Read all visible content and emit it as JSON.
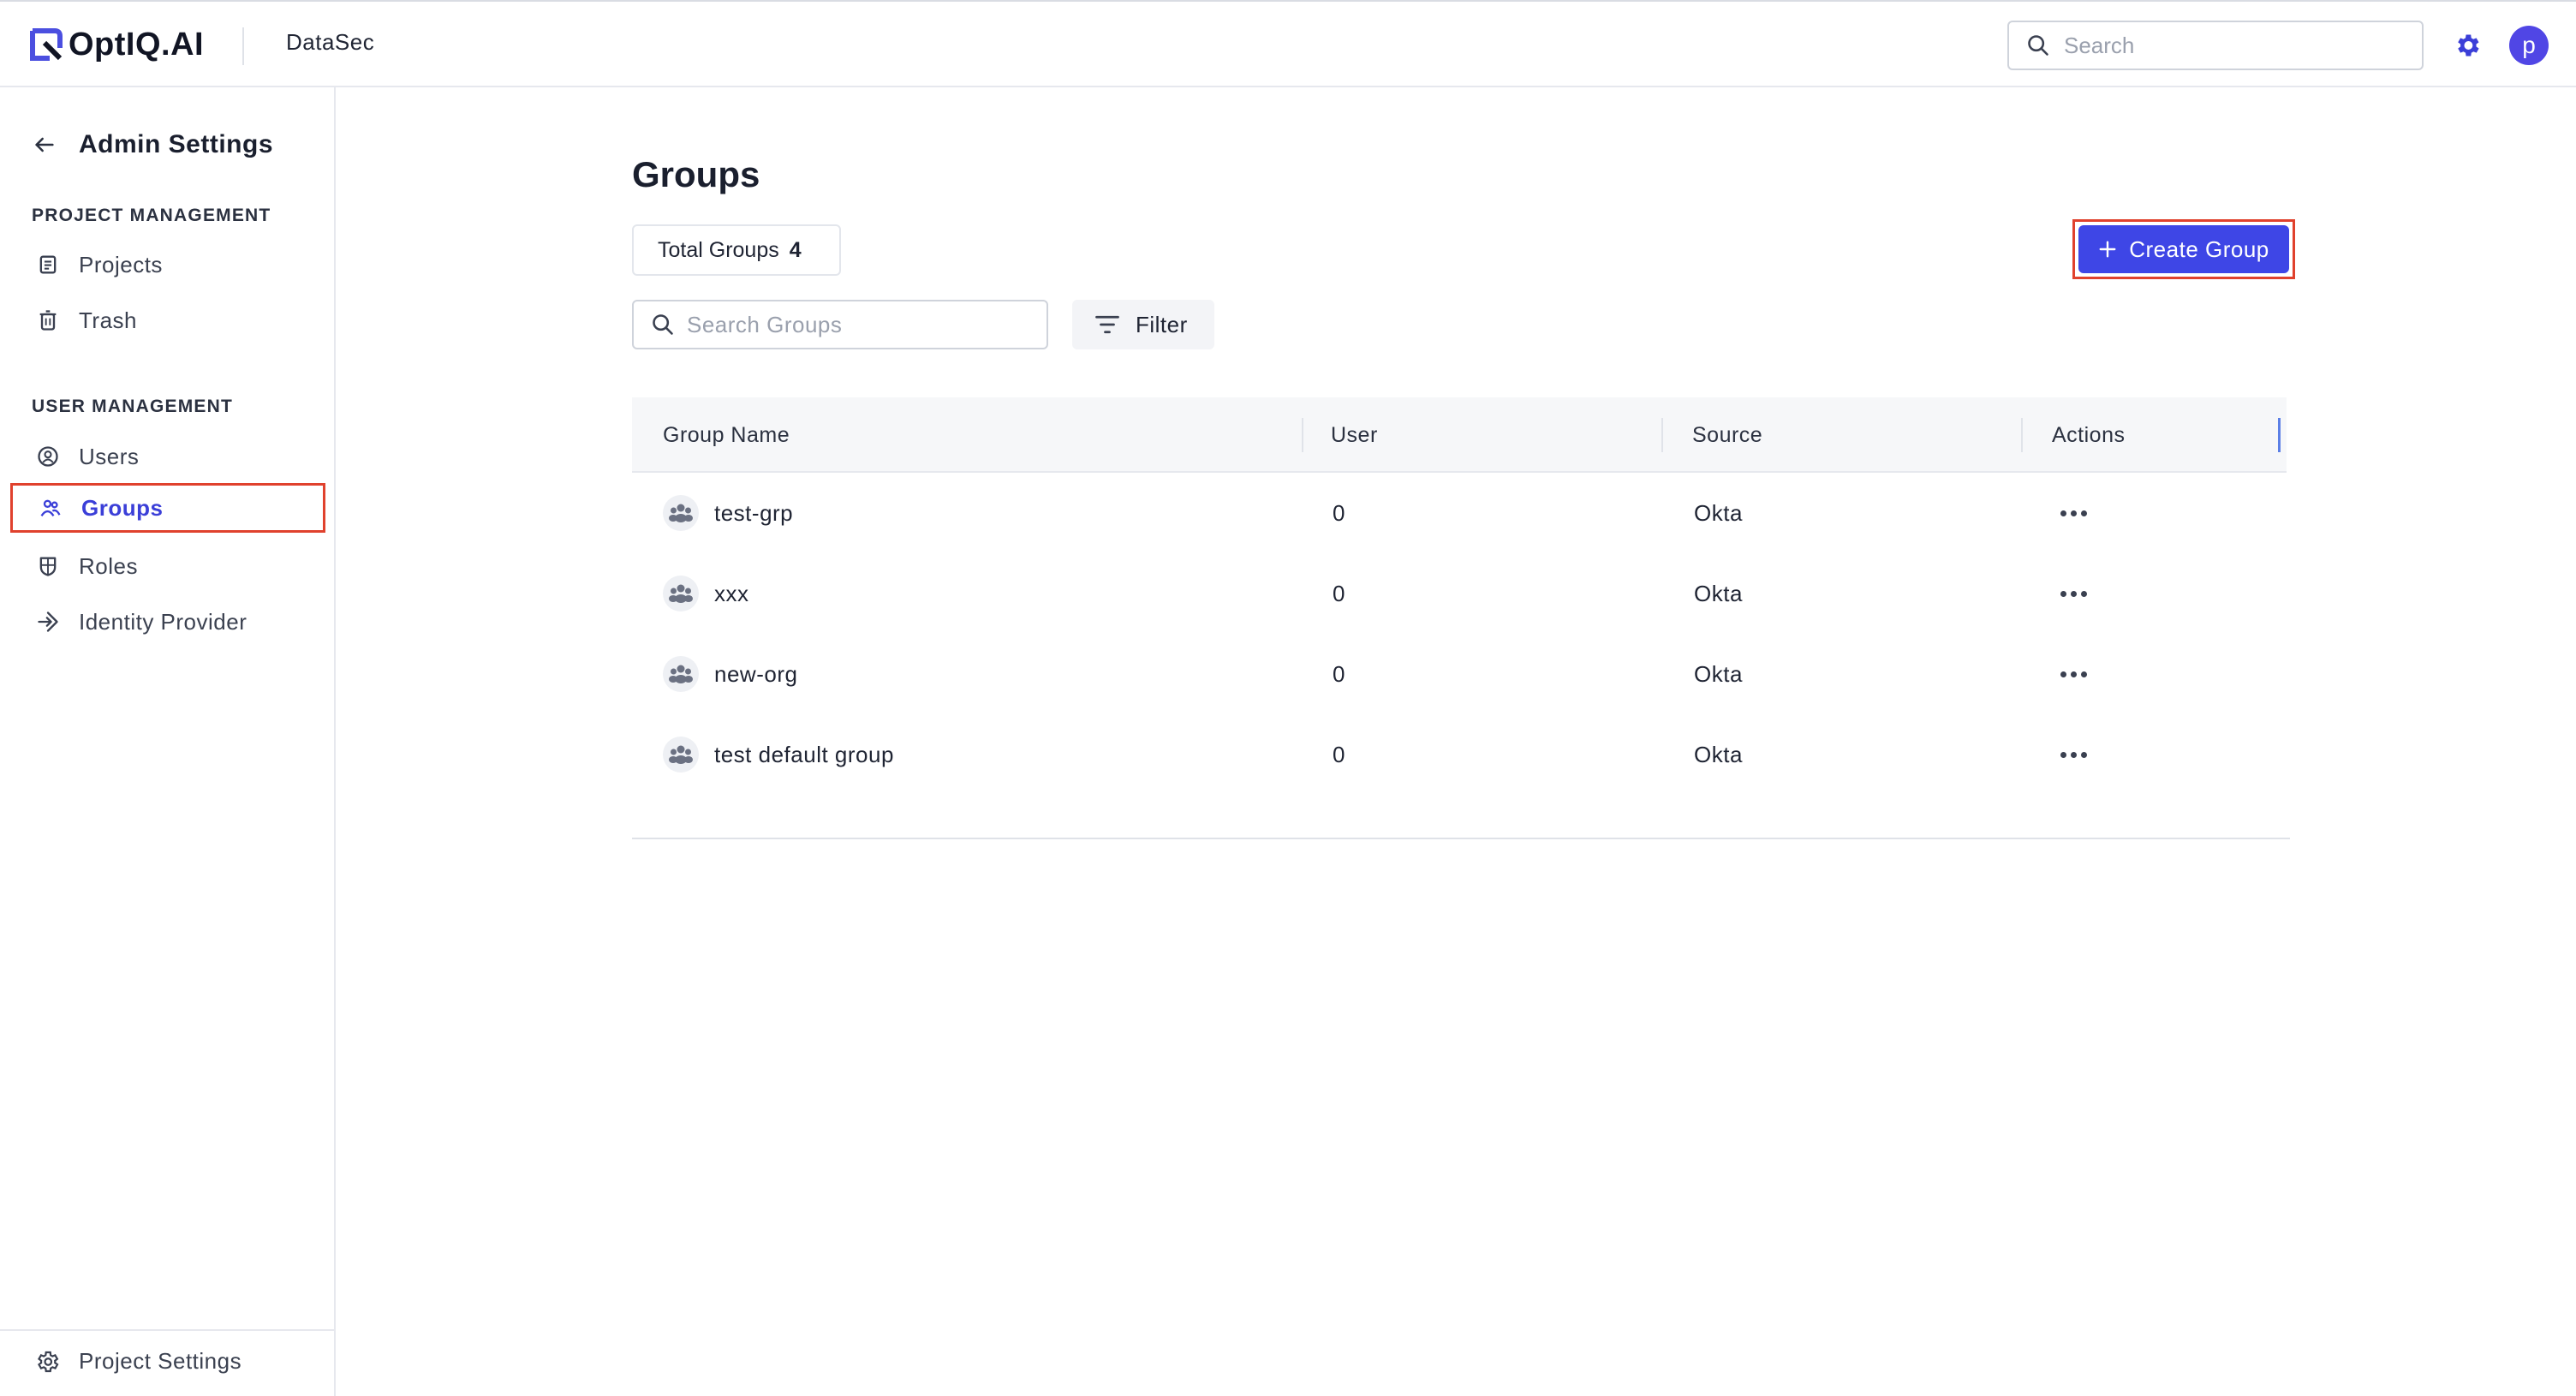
{
  "topbar": {
    "logo_text": "OptIQ.AI",
    "product_name": "DataSec",
    "search_placeholder": "Search",
    "avatar_initial": "p"
  },
  "sidebar": {
    "title": "Admin Settings",
    "sections": [
      {
        "label": "PROJECT MANAGEMENT",
        "items": [
          {
            "label": "Projects",
            "icon": "document-icon"
          },
          {
            "label": "Trash",
            "icon": "trash-icon"
          }
        ]
      },
      {
        "label": "USER MANAGEMENT",
        "items": [
          {
            "label": "Users",
            "icon": "user-circle-icon"
          },
          {
            "label": "Groups",
            "icon": "group-icon",
            "active": true
          },
          {
            "label": "Roles",
            "icon": "shield-icon"
          },
          {
            "label": "Identity Provider",
            "icon": "login-arrow-icon"
          }
        ]
      }
    ],
    "footer_label": "Project Settings"
  },
  "main": {
    "title": "Groups",
    "total_label": "Total Groups",
    "total_count": "4",
    "create_button": "Create Group",
    "search_placeholder": "Search Groups",
    "filter_label": "Filter",
    "table": {
      "columns": [
        "Group Name",
        "User",
        "Source",
        "Actions"
      ],
      "rows": [
        {
          "name": "test-grp",
          "users": "0",
          "source": "Okta"
        },
        {
          "name": "xxx",
          "users": "0",
          "source": "Okta"
        },
        {
          "name": "new-org",
          "users": "0",
          "source": "Okta"
        },
        {
          "name": "test default group",
          "users": "0",
          "source": "Okta"
        }
      ]
    }
  },
  "colors": {
    "accent": "#3e46e6",
    "highlight_border": "#e0412d",
    "active_text": "#3b3fd8"
  }
}
